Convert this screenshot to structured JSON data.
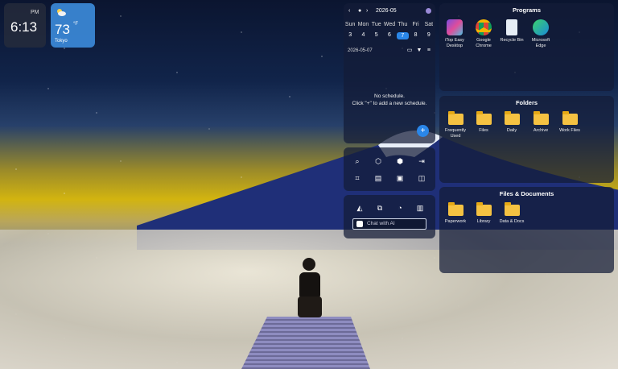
{
  "clock": {
    "ampm": "PM",
    "time": "6:13"
  },
  "weather": {
    "icon": "partly-cloudy-icon",
    "temp": "73",
    "unit": "°F",
    "city": "Tokyo"
  },
  "calendar": {
    "month_label": "2026-05",
    "weekdays": [
      "Sun",
      "Mon",
      "Tue",
      "Wed",
      "Thu",
      "Fri",
      "Sat"
    ],
    "days": [
      "3",
      "4",
      "5",
      "6",
      "7",
      "8",
      "9"
    ],
    "selected_day": "7",
    "selected_date": "2026-05-07",
    "empty_line1": "No schedule.",
    "empty_line2": "Click \"+\" to add a new schedule.",
    "add_label": "+"
  },
  "tools": {
    "ai_placeholder": "Chat with AI"
  },
  "programs": {
    "title": "Programs",
    "items": [
      {
        "label1": "iTop Easy",
        "label2": "Desktop"
      },
      {
        "label1": "Google",
        "label2": "Chrome"
      },
      {
        "label1": "Recycle Bin",
        "label2": ""
      },
      {
        "label1": "Microsoft",
        "label2": "Edge"
      }
    ]
  },
  "folders": {
    "title": "Folders",
    "items": [
      {
        "label1": "Frequently",
        "label2": "Used"
      },
      {
        "label1": "Files",
        "label2": ""
      },
      {
        "label1": "Daily",
        "label2": ""
      },
      {
        "label1": "Archive",
        "label2": ""
      },
      {
        "label1": "Work Files",
        "label2": ""
      }
    ]
  },
  "files": {
    "title": "Files & Documents",
    "items": [
      {
        "label1": "Paperwork",
        "label2": ""
      },
      {
        "label1": "Library",
        "label2": ""
      },
      {
        "label1": "Data & Docs",
        "label2": ""
      }
    ]
  },
  "colors": {
    "accent": "#2a86e8",
    "folder": "#f5c242",
    "panel": "#141c37"
  }
}
